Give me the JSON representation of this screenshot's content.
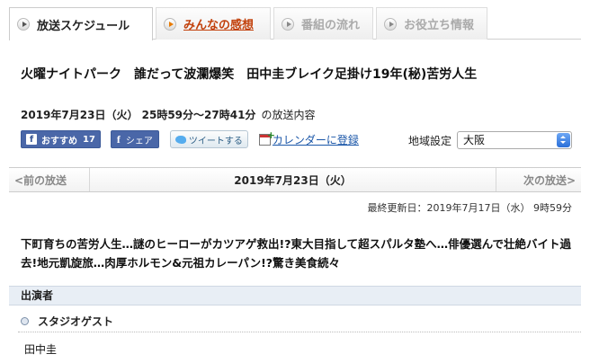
{
  "tabs": [
    {
      "label": "放送スケジュール",
      "active": true,
      "link": false,
      "icon": "play-icon"
    },
    {
      "label": "みんなの感想",
      "active": false,
      "link": true,
      "icon": "play-icon"
    },
    {
      "label": "番組の流れ",
      "active": false,
      "link": false,
      "icon": "play-icon"
    },
    {
      "label": "お役立ち情報",
      "active": false,
      "link": false,
      "icon": "play-icon"
    }
  ],
  "program": {
    "title": "火曜ナイトパーク　誰だって波瀾爆笑　田中圭ブレイク足掛け19年(秘)苦労人生",
    "broadcast_time": "2019年7月23日（火）  25時59分～27時41分",
    "broadcast_suffix": "の放送内容"
  },
  "social": {
    "fb_like_label": "おすすめ",
    "fb_like_count": "17",
    "fb_share_label": "シェア",
    "tweet_label": "ツイートする",
    "calendar_label": "カレンダーに登録"
  },
  "region": {
    "label": "地域設定",
    "selected": "大阪"
  },
  "date_nav": {
    "prev_label": "<前の放送",
    "current_date": "2019年7月23日（火）",
    "next_label": "次の放送>"
  },
  "updated": "最終更新日：2019年7月17日（水） 9時59分",
  "summary": "下町育ちの苦労人生…謎のヒーローがカツアゲ救出!?東大目指して超スパルタ塾へ…俳優選んで壮絶バイト過去!地元凱旋旅…肉厚ホルモン&元祖カレーパン!?驚き美食続々",
  "cast": {
    "header": "出演者",
    "group_label": "スタジオゲスト",
    "members": [
      "田中圭"
    ]
  },
  "colors": {
    "facebook": "#4a67a8",
    "link": "#1a56a8",
    "tab_link": "#c2410c",
    "cast_header_bg": "#e8eef5"
  }
}
